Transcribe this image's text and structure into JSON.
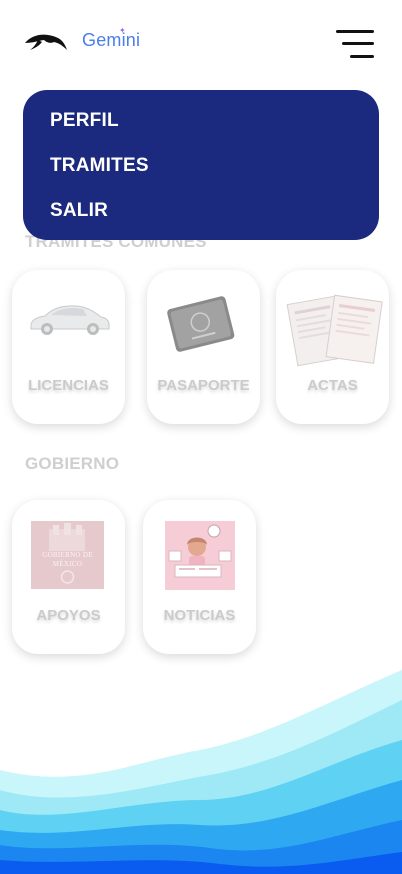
{
  "header": {
    "logo_icon": "dolphin-logo-icon",
    "brand_text": "Gemini",
    "menu_icon": "hamburger-menu-icon"
  },
  "menu": {
    "items": [
      {
        "label": "PERFIL"
      },
      {
        "label": "TRAMITES"
      },
      {
        "label": "SALIR"
      }
    ]
  },
  "sections": [
    {
      "title": "TRAMITES COMUNES",
      "cards": [
        {
          "label": "LICENCIAS",
          "icon": "car-icon"
        },
        {
          "label": "PASAPORTE",
          "icon": "passport-icon"
        },
        {
          "label": "ACTAS",
          "icon": "documents-icon"
        }
      ]
    },
    {
      "title": "GOBIERNO",
      "cards": [
        {
          "label": "APOYOS",
          "icon": "gobierno-mexico-icon",
          "image_text": "GOBIERNO DE MÉXICO"
        },
        {
          "label": "NOTICIAS",
          "icon": "news-icon"
        }
      ]
    }
  ],
  "colors": {
    "menu_background": "#1b2a7e",
    "brand": "#4a7ee8",
    "wave_dark": "#0a5cf0",
    "wave_light": "#bff3fb"
  }
}
